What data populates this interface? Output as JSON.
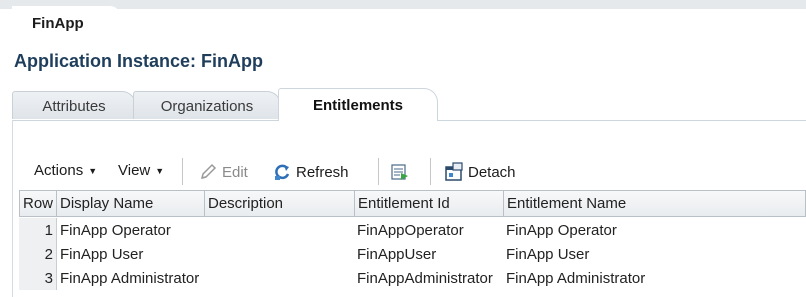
{
  "app_tab": {
    "label": "FinApp"
  },
  "page_title": "Application Instance: FinApp",
  "tabs": [
    {
      "label": "Attributes",
      "active": false
    },
    {
      "label": "Organizations",
      "active": false
    },
    {
      "label": "Entitlements",
      "active": true
    }
  ],
  "toolbar": {
    "actions_label": "Actions",
    "view_label": "View",
    "edit_label": "Edit",
    "refresh_label": "Refresh",
    "detach_label": "Detach"
  },
  "table": {
    "columns": [
      "Row",
      "Display Name",
      "Description",
      "Entitlement Id",
      "Entitlement Name"
    ],
    "rows": [
      {
        "row": "1",
        "display_name": "FinApp Operator",
        "description": "",
        "entitlement_id": "FinAppOperator",
        "entitlement_name": "FinApp Operator"
      },
      {
        "row": "2",
        "display_name": "FinApp User",
        "description": "",
        "entitlement_id": "FinAppUser",
        "entitlement_name": "FinApp User"
      },
      {
        "row": "3",
        "display_name": "FinApp Administrator",
        "description": "",
        "entitlement_id": "FinAppAdministrator",
        "entitlement_name": "FinApp Administrator"
      }
    ]
  },
  "colors": {
    "title": "#1f3e5c",
    "header_bg": "#e9ecef",
    "disabled_text": "#8a8a8a"
  }
}
